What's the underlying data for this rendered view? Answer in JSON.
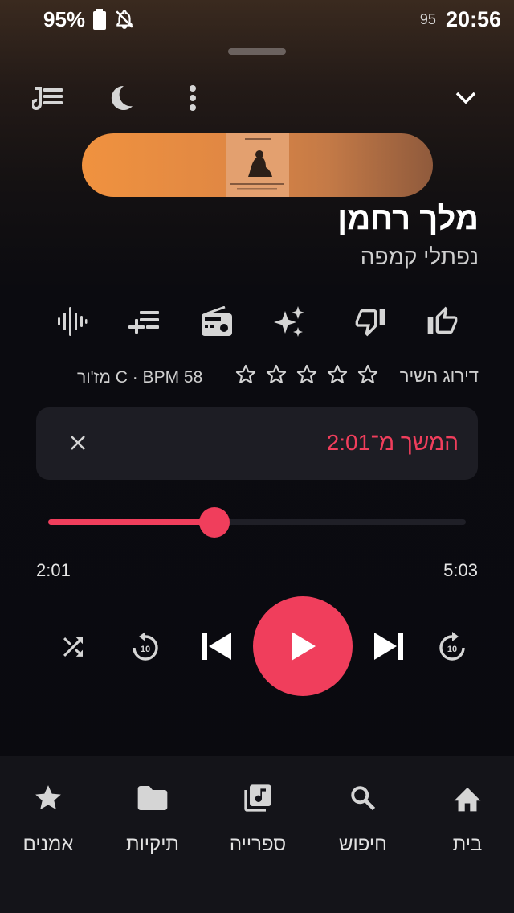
{
  "status_bar": {
    "battery": "95%",
    "network": "95",
    "time": "20:56"
  },
  "now_playing": {
    "title": "מלך רחמן",
    "artist": "נפתלי קמפה"
  },
  "rating": {
    "label": "דירוג השיר",
    "stars_filled": 0,
    "stars_total": 5,
    "bpm_text": "58 C · BPM מז'ור"
  },
  "resume": {
    "text": "המשך מ־2:01"
  },
  "progress": {
    "current": "2:01",
    "duration": "5:03",
    "fraction": 0.399
  },
  "nav": {
    "items": [
      {
        "label": "בית",
        "icon": "home-icon"
      },
      {
        "label": "חיפוש",
        "icon": "search-icon"
      },
      {
        "label": "ספרייה",
        "icon": "library-music-icon"
      },
      {
        "label": "תיקיות",
        "icon": "folder-icon"
      },
      {
        "label": "אמנים",
        "icon": "star-icon"
      }
    ]
  },
  "colors": {
    "accent": "#f03e5c",
    "card": "#1d1d24",
    "nav_bg": "#141419"
  }
}
